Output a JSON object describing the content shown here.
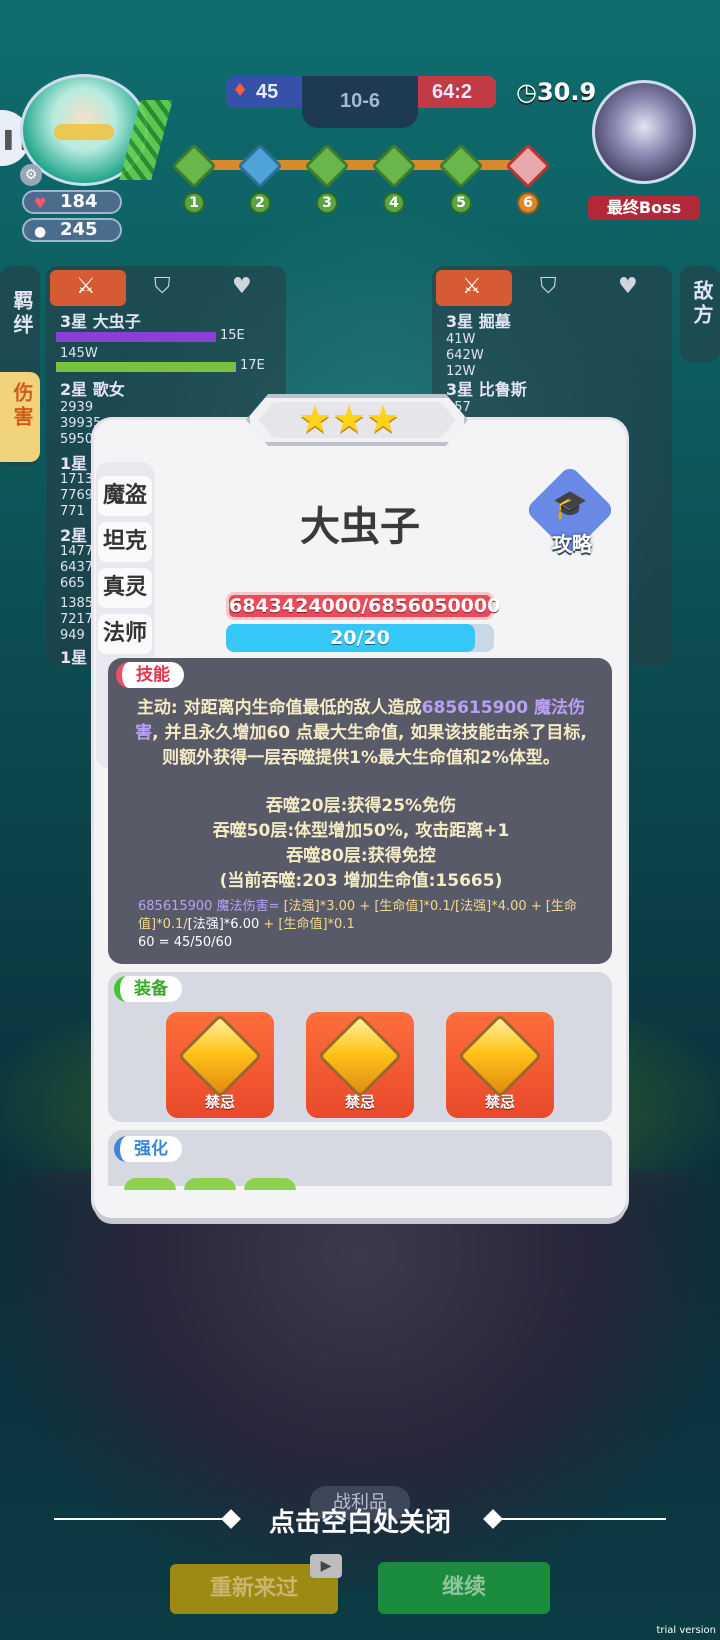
{
  "hud": {
    "blue_score": "45",
    "round": "10-6",
    "red_score": "64:2",
    "timer": "30.9",
    "player_hp": "184",
    "player_gold": "245",
    "boss_label": "最终Boss",
    "stages": [
      "1",
      "2",
      "3",
      "4",
      "5",
      "6"
    ]
  },
  "left_panel": {
    "tab_bond": "羁绊",
    "tab_damage": "伤害",
    "rows": [
      {
        "name": "3星 大虫子",
        "v1": "15E",
        "v2": "145W",
        "v3": "17E"
      },
      {
        "name": "2星 歌女",
        "v1": "2939",
        "v2": "39935",
        "v3": "5950"
      },
      {
        "name": "1星",
        "v1": "1713",
        "v2": "7769",
        "v3": "771"
      },
      {
        "name": "2星",
        "v1": "1477",
        "v2": "6437",
        "v3": "665"
      },
      {
        "name": "",
        "v1": "1385",
        "v2": "7217",
        "v3": "949"
      },
      {
        "name": "1星",
        "v1": "",
        "v2": "",
        "v3": ""
      }
    ]
  },
  "right_panel": {
    "tab_enemy": "敌方",
    "rows": [
      {
        "name": "3星 掘墓",
        "v1": "41W",
        "v2": "642W",
        "v3": "12W"
      },
      {
        "name": "3星 比鲁斯",
        "v1": "957",
        "v2": "",
        "v3": ""
      }
    ]
  },
  "modal": {
    "stars": 3,
    "class_tabs": [
      "魔盗",
      "坦克",
      "真灵",
      "法师"
    ],
    "hero_name": "大虫子",
    "guide_label": "攻略",
    "hp_text": "6843424000/6856050000",
    "mana_text": "20/20",
    "mana_fraction": 0.93,
    "skill_tag": "技能",
    "skill_main_1": "主动: 对距离内生命值最低的敌人造成",
    "skill_main_value": "685615900",
    "skill_main_2": "魔法伤害",
    "skill_main_3": ", 并且永久增加60 点最大生命值, 如果该技能击杀了目标, 则额外获得一层吞噬提供1%最大生命值和2%体型。",
    "skill_lines": [
      "吞噬20层:获得25%免伤",
      "吞噬50层:体型增加50%, 攻击距离+1",
      "吞噬80层:获得免控",
      "(当前吞噬:203 增加生命值:15665)"
    ],
    "formula_value": "685615900 魔法伤害=",
    "formula_1": " [法强]*3.00 + [生命值]*0.1/[法强]*4.00 + [生命值]*0.1/",
    "formula_2": "[法强]*6.00",
    "formula_3": " + [生命值]*0.1",
    "formula_4": "60 = 45/50/60",
    "equip_tag": "装备",
    "equipment": [
      "禁忌",
      "禁忌",
      "禁忌"
    ],
    "enhance_tag": "强化"
  },
  "bottom": {
    "close_hint": "点击空白处关闭",
    "loot_label": "战利品",
    "restart_label": "重新来过",
    "continue_label": "继续",
    "trial_text": "trial version"
  }
}
